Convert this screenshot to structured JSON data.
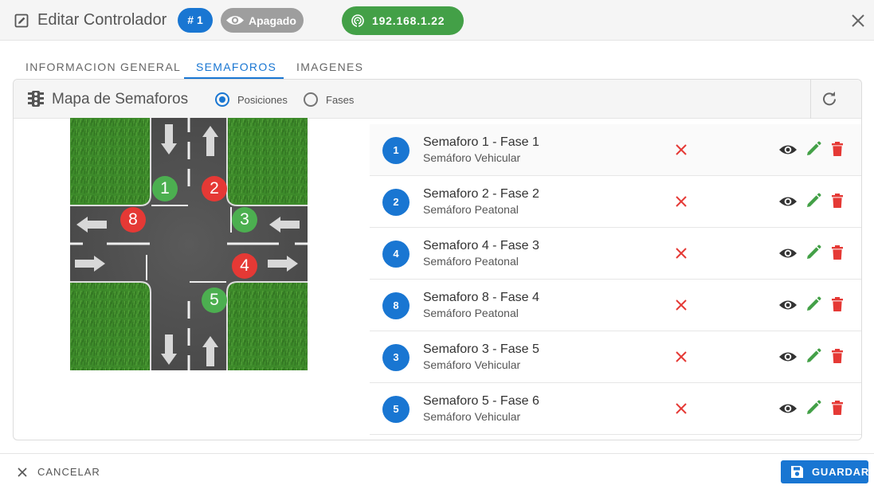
{
  "header": {
    "title": "Editar Controlador",
    "controller_number": "# 1",
    "status": "Apagado",
    "ip": "192.168.1.22"
  },
  "tabs": [
    {
      "label": "INFORMACION GENERAL",
      "active": false
    },
    {
      "label": "SEMAFOROS",
      "active": true
    },
    {
      "label": "IMAGENES",
      "active": false
    }
  ],
  "panel": {
    "title": "Mapa de Semaforos",
    "radio_options": [
      {
        "label": "Posiciones",
        "selected": true
      },
      {
        "label": "Fases",
        "selected": false
      }
    ]
  },
  "map_markers": [
    {
      "label": "1",
      "color": "#4caf50"
    },
    {
      "label": "2",
      "color": "#e53935"
    },
    {
      "label": "8",
      "color": "#e53935"
    },
    {
      "label": "3",
      "color": "#4caf50"
    },
    {
      "label": "4",
      "color": "#e53935"
    },
    {
      "label": "5",
      "color": "#4caf50"
    }
  ],
  "semaforos": [
    {
      "number": "1",
      "title": "Semaforo 1 - Fase 1",
      "type": "Semáforo Vehicular"
    },
    {
      "number": "2",
      "title": "Semaforo 2 - Fase 2",
      "type": "Semáforo Peatonal"
    },
    {
      "number": "4",
      "title": "Semaforo 4 - Fase 3",
      "type": "Semáforo Peatonal"
    },
    {
      "number": "8",
      "title": "Semaforo 8 - Fase 4",
      "type": "Semáforo Peatonal"
    },
    {
      "number": "3",
      "title": "Semaforo 3 - Fase 5",
      "type": "Semáforo Vehicular"
    },
    {
      "number": "5",
      "title": "Semaforo 5 - Fase 6",
      "type": "Semáforo Vehicular"
    }
  ],
  "footer": {
    "cancel_label": "CANCELAR",
    "save_label": "GUARDAR"
  },
  "colors": {
    "primary": "#1976d2",
    "success": "#43a047",
    "danger": "#e53935",
    "status_off": "#9e9e9e"
  },
  "icons": [
    "edit-square-icon",
    "eye-icon",
    "wifi-signal-icon",
    "close-icon",
    "traffic-light-icon",
    "refresh-icon",
    "x-mark-icon",
    "pencil-icon",
    "trash-icon",
    "floppy-disk-icon"
  ]
}
